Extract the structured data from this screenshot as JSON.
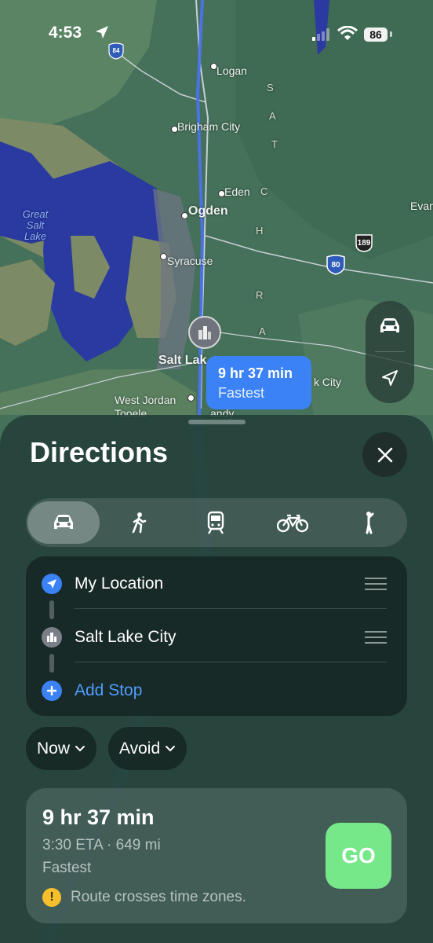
{
  "status_bar": {
    "time": "4:53",
    "battery": "86"
  },
  "map": {
    "labels": {
      "logan": "Logan",
      "brigham_city": "Brigham City",
      "eden": "Eden",
      "ogden": "Ogden",
      "syracuse": "Syracuse",
      "salt_lake": "Salt Lak",
      "west_jordan": "West Jordan",
      "tooele": "Tooele",
      "sandy": "andy",
      "evanston": "Evan",
      "k_city": "k City",
      "great_salt_lake": "Great\nSalt\nLake",
      "wasatch_range": [
        "S",
        "A",
        "T",
        "C",
        "H"
      ],
      "wasatch_range2": [
        "R",
        "A"
      ]
    },
    "shields": {
      "i80": "80",
      "us189": "189",
      "i84": "84"
    },
    "route_callout": {
      "duration": "9 hr 37 min",
      "label": "Fastest"
    },
    "colors": {
      "callout": "#3a82f6",
      "go": "#76e889",
      "accent_blue": "#4f9cff"
    }
  },
  "sheet": {
    "title": "Directions",
    "transport_modes": [
      {
        "icon": "car-icon",
        "active": true
      },
      {
        "icon": "walk-icon",
        "active": false
      },
      {
        "icon": "transit-icon",
        "active": false
      },
      {
        "icon": "bicycle-icon",
        "active": false
      },
      {
        "icon": "rideshare-icon",
        "active": false
      }
    ],
    "stops": [
      {
        "label": "My Location",
        "icon": "location-arrow-icon"
      },
      {
        "label": "Salt Lake City",
        "icon": "city-icon"
      }
    ],
    "add_stop": "Add Stop",
    "options": {
      "now": "Now",
      "avoid": "Avoid"
    },
    "route": {
      "duration": "9 hr 37 min",
      "eta": "3:30 ETA · 649 mi",
      "label": "Fastest",
      "warning": "Route crosses time zones.",
      "go": "GO"
    }
  }
}
